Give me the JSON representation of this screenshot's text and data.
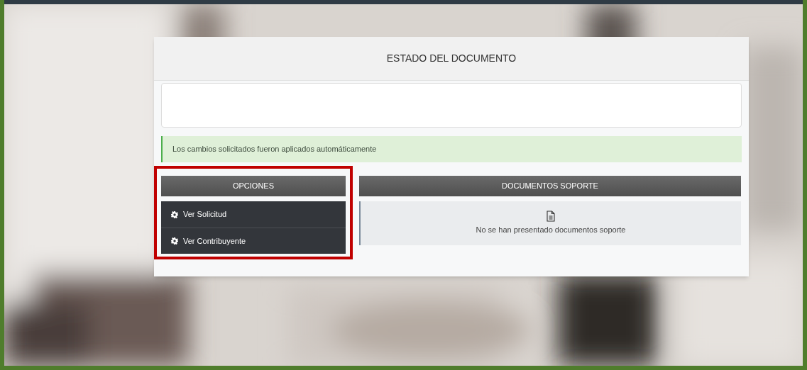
{
  "card": {
    "title": "ESTADO DEL DOCUMENTO"
  },
  "alert": {
    "message": "Los cambios solicitados fueron aplicados automáticamente"
  },
  "options_panel": {
    "title": "OPCIONES",
    "highlighted": true,
    "items": [
      {
        "label": "Ver Solicitud"
      },
      {
        "label": "Ver Contribuyente"
      }
    ]
  },
  "support_panel": {
    "title": "DOCUMENTOS SOPORTE",
    "empty_text": "No se han presentado documentos soporte"
  }
}
